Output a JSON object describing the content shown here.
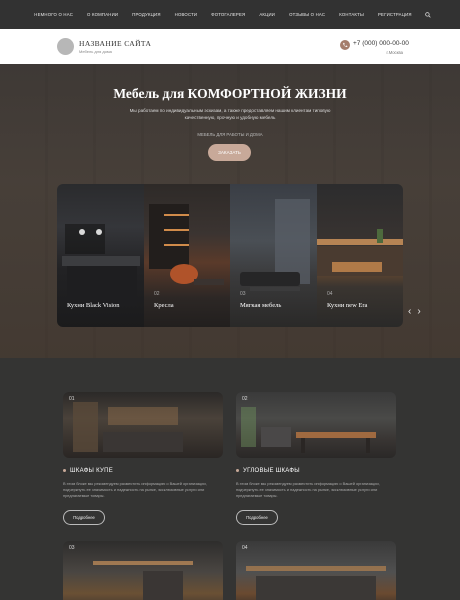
{
  "topnav": {
    "items": [
      "НЕМНОГО О НАС",
      "О КОМПАНИИ",
      "ПРОДУКЦИЯ",
      "НОВОСТИ",
      "ФОТОГАЛЕРЕЯ",
      "АКЦИИ",
      "ОТЗЫВЫ О НАС",
      "КОНТАКТЫ",
      "РЕГИСТРАЦИЯ"
    ],
    "search_icon": "search-icon"
  },
  "header": {
    "site_name": "НАЗВАНИЕ САЙТА",
    "site_sub": "Мебель для дома",
    "phone": "+7 (000) 000-00-00",
    "city": "г.Москва",
    "phone_icon": "phone-icon"
  },
  "hero": {
    "title": "Мебель для КОМФОРТНОЙ ЖИЗНИ",
    "description": "Мы работаем по индивидуальным эскизам, а также предоставляем нашим клиентам типовую качественную, прочную и удобную мебель",
    "kicker": "МЕБЕЛЬ ДЛЯ РАБОТЫ И ДОМА",
    "button": "ЗАКАЗАТЬ",
    "cards": [
      {
        "num": "",
        "caption": "Кухни Black Vision"
      },
      {
        "num": "02",
        "caption": "Кресла"
      },
      {
        "num": "03",
        "caption": "Мягкая мебель"
      },
      {
        "num": "04",
        "caption": "Кухни new Era"
      }
    ],
    "prev": "‹",
    "next": "›"
  },
  "products": [
    {
      "num": "01",
      "title": "ШКАФЫ КУПЕ",
      "description": "В этом блоке мы рекомендуем разместить информацию о Вашей организации, подчеркнуть ее значимость и надежность на рынке, эксклюзивные услуги или предлагаемые товары.",
      "button": "Подробнее"
    },
    {
      "num": "02",
      "title": "УГЛОВЫЕ ШКАФЫ",
      "description": "В этом блоке мы рекомендуем разместить информацию о Вашей организации, подчеркнуть ее значимость и надежность на рынке, эксклюзивные услуги или предлагаемые товары.",
      "button": "Подробнее"
    },
    {
      "num": "03"
    },
    {
      "num": "04"
    }
  ]
}
